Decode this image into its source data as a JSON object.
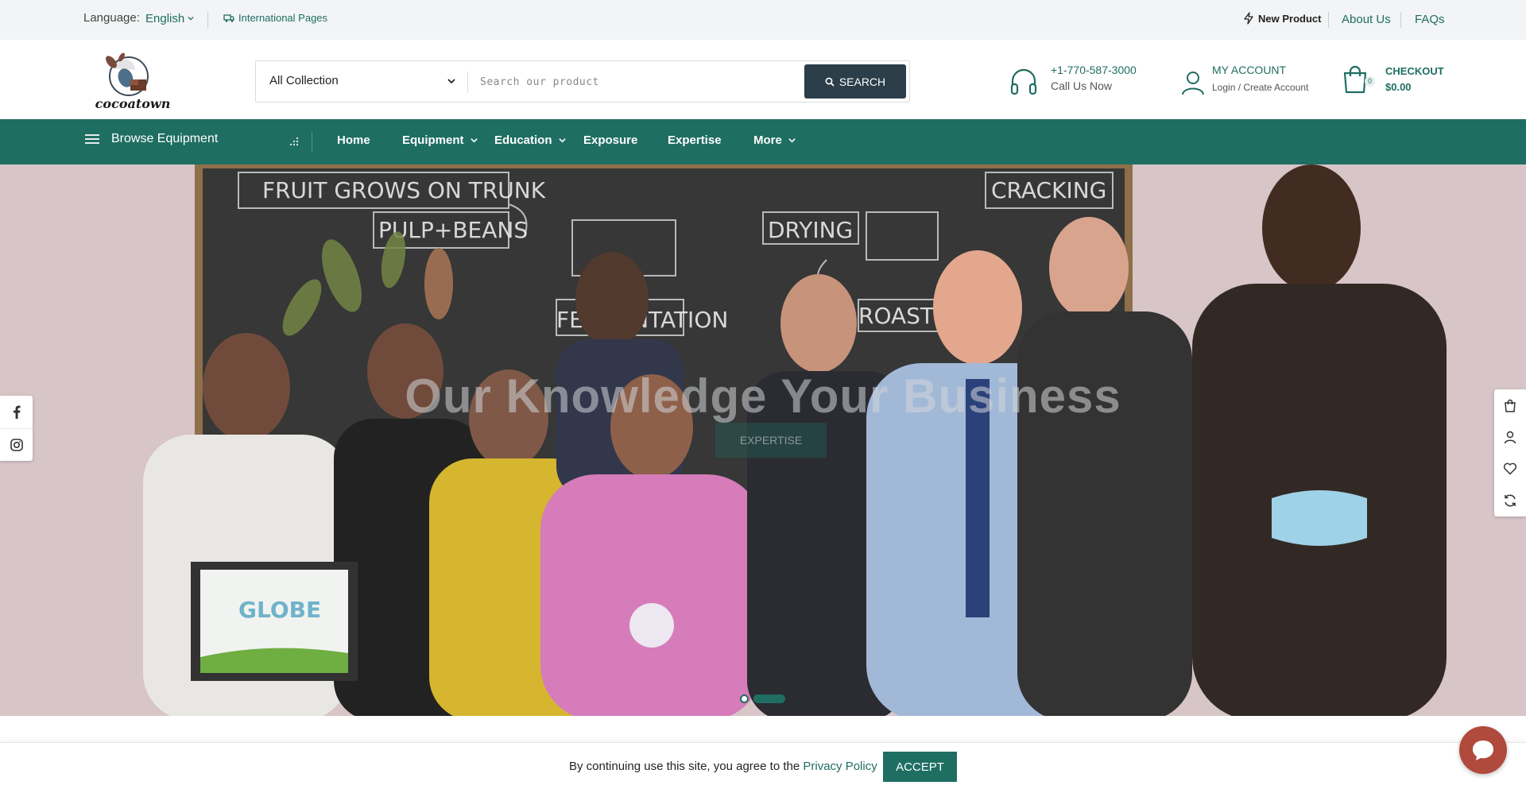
{
  "topbar": {
    "language_label": "Language:",
    "language_value": "English",
    "international": "International Pages",
    "new_product": "New Product",
    "about": "About Us",
    "faqs": "FAQs"
  },
  "header": {
    "collection": "All Collection",
    "search_placeholder": "Search our product",
    "search_button": "SEARCH",
    "phone": "+1-770-587-3000",
    "call_now": "Call Us Now",
    "account_title": "MY ACCOUNT",
    "account_sub": "Login / Create Account",
    "checkout_title": "CHECKOUT",
    "checkout_amount": "$0.00",
    "cart_count": "0"
  },
  "nav": {
    "browse": "Browse Equipment",
    "items": [
      "Home",
      "Equipment",
      "Education",
      "Exposure",
      "Expertise",
      "More"
    ]
  },
  "hero": {
    "headline": "Our Knowledge Your Business",
    "button": "EXPERTISE"
  },
  "cookie": {
    "message": "By continuing use this site, you agree to the",
    "link": "Privacy Policy",
    "accept": "ACCEPT"
  },
  "colors": {
    "brand": "#1f6e62",
    "dark": "#2b3e4a"
  }
}
